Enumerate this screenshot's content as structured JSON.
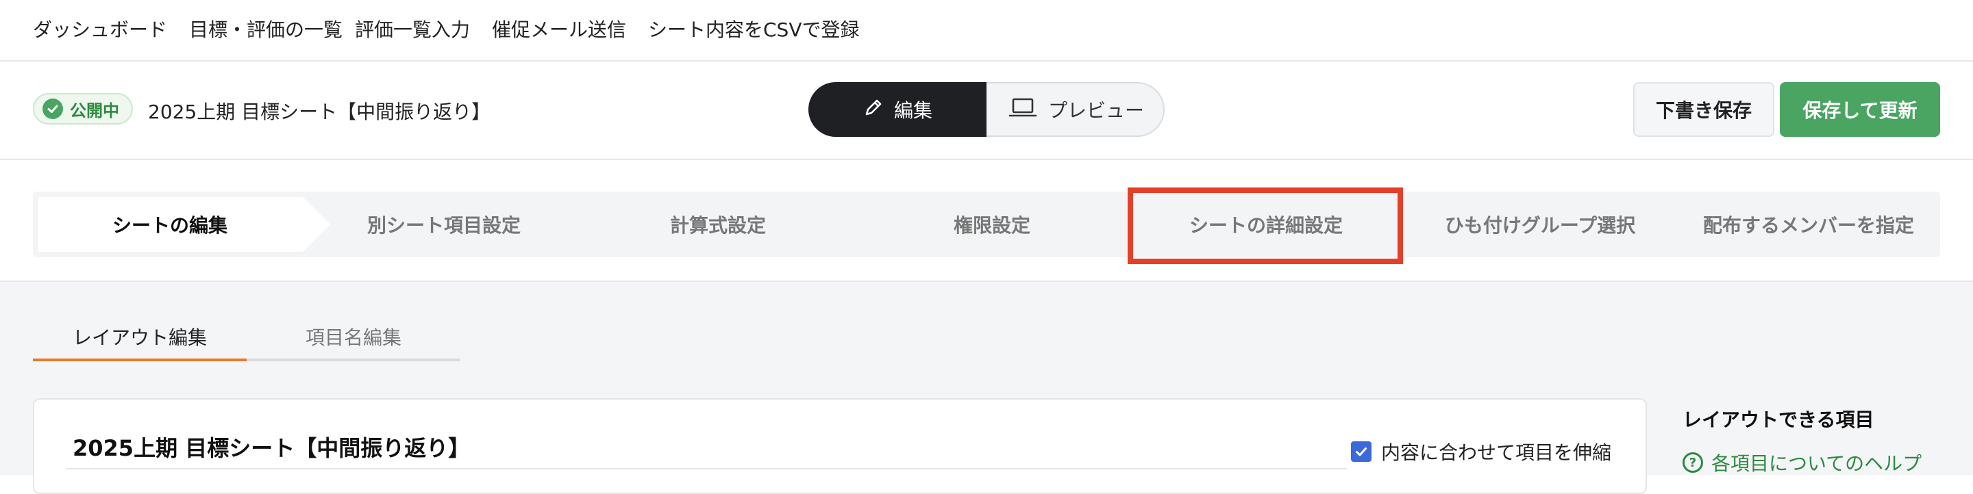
{
  "topnav": {
    "items": [
      "ダッシュボード",
      "目標・評価の一覧",
      "評価一覧入力",
      "催促メール送信",
      "シート内容をCSVで登録"
    ]
  },
  "header": {
    "status_label": "公開中",
    "sheet_title": "2025上期 目標シート【中間振り返り】",
    "mode_edit_label": "編集",
    "mode_preview_label": "プレビュー",
    "draft_button_label": "下書き保存",
    "save_button_label": "保存して更新"
  },
  "steps": {
    "items": [
      "シートの編集",
      "別シート項目設定",
      "計算式設定",
      "権限設定",
      "シートの詳細設定",
      "ひも付けグループ選択",
      "配布するメンバーを指定"
    ],
    "active_index": 0,
    "highlighted_index": 4
  },
  "content": {
    "tabs": [
      "レイアウト編集",
      "項目名編集"
    ],
    "active_tab_index": 0,
    "panel_title": "2025上期 目標シート【中間振り返り】",
    "stretch_checkbox_label": "内容に合わせて項目を伸縮",
    "stretch_checked": true
  },
  "sidebar": {
    "title": "レイアウトできる項目",
    "help_link_label": "各項目についてのヘルプ"
  },
  "colors": {
    "accent_green": "#4aa462",
    "tab_underline": "#e8782a",
    "highlight_red": "#e3402a",
    "checkbox_blue": "#3b6ad8"
  }
}
